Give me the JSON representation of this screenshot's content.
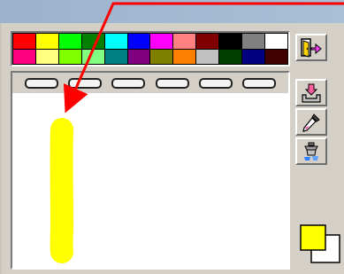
{
  "palette": {
    "colors": [
      "#ff0000",
      "#ffff00",
      "#00ff00",
      "#007f00",
      "#00ffff",
      "#0000ff",
      "#ff00ff",
      "#ff8080",
      "#800000",
      "#000000",
      "#808080",
      "#ffffff",
      "#ff0080",
      "#ffff80",
      "#80ff00",
      "#80ff80",
      "#008080",
      "#800080",
      "#808000",
      "#ff8000",
      "#c0c0c0",
      "#004000",
      "#000080",
      "#400000"
    ]
  },
  "slots": {
    "count": 6
  },
  "tools": {
    "items": [
      "exit-door-icon",
      "import-image-icon",
      "eyedropper-icon",
      "paint-bucket-icon"
    ]
  },
  "current_color": {
    "foreground": "#ffff00",
    "background": "#ffffff"
  },
  "annotation": {
    "arrow_color": "#ff0000"
  },
  "stroke": {
    "color": "#ffff00"
  }
}
